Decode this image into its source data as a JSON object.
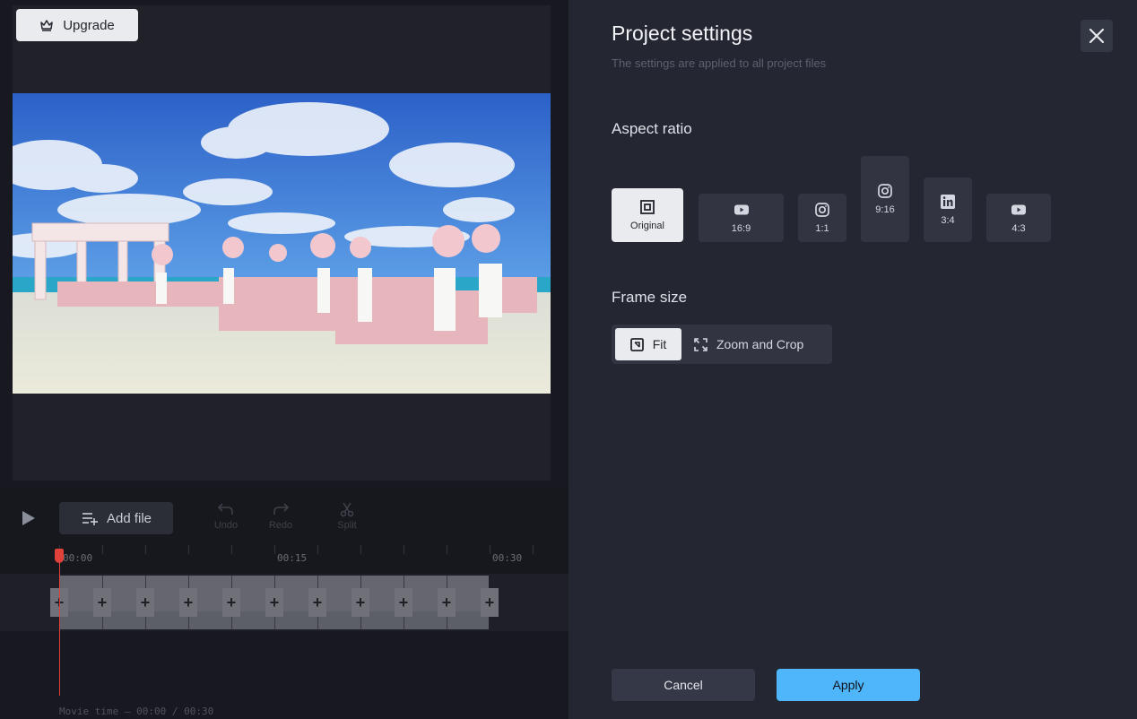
{
  "editor": {
    "upgrade_label": "Upgrade",
    "add_file_label": "Add file",
    "undo_label": "Undo",
    "redo_label": "Redo",
    "split_label": "Split",
    "timeline": {
      "ticks": [
        "00:00",
        "00:15",
        "00:30"
      ]
    },
    "movie_time_prefix": "Movie time –",
    "movie_time_value": "00:00 / 00:30"
  },
  "panel": {
    "title": "Project settings",
    "subtitle": "The settings are applied to all project files",
    "aspect_ratio_title": "Aspect ratio",
    "aspect_ratios": [
      {
        "label": "Original",
        "icon": "original-icon",
        "selected": true
      },
      {
        "label": "16:9",
        "icon": "youtube-icon",
        "selected": false
      },
      {
        "label": "1:1",
        "icon": "instagram-icon",
        "selected": false
      },
      {
        "label": "9:16",
        "icon": "instagram-icon",
        "selected": false
      },
      {
        "label": "3:4",
        "icon": "linkedin-icon",
        "selected": false
      },
      {
        "label": "4:3",
        "icon": "youtube-icon",
        "selected": false
      }
    ],
    "frame_size_title": "Frame size",
    "frame_options": [
      {
        "label": "Fit",
        "icon": "fit-icon",
        "selected": true
      },
      {
        "label": "Zoom and Crop",
        "icon": "zoom-crop-icon",
        "selected": false
      }
    ],
    "cancel_label": "Cancel",
    "apply_label": "Apply"
  },
  "colors": {
    "accent": "#4fb6fb",
    "playhead": "#e0413b",
    "panel_bg": "#242631"
  }
}
